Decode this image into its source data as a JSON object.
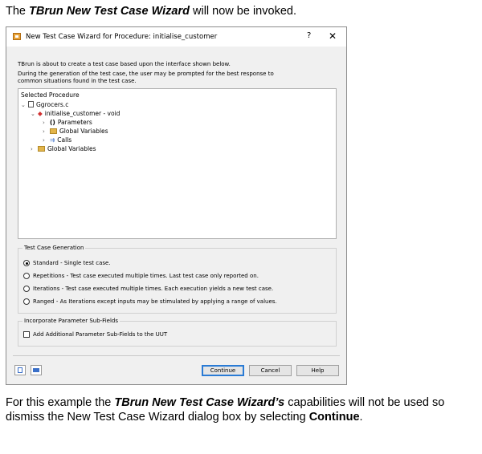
{
  "doc": {
    "intro": {
      "prefix": "The ",
      "emph": "TBrun New Test Case Wizard",
      "suffix": " will now be invoked."
    },
    "outro": {
      "p1": "For this example the ",
      "emph": "TBrun New Test Case Wizard’s",
      "p2": " capabilities will not be used so dismiss the New Test Case Wizard dialog box by selecting ",
      "bold": "Continue",
      "p3": "."
    }
  },
  "dialog": {
    "title": "New Test Case Wizard for Procedure: initialise_customer",
    "help_label": "?",
    "close_label": "✕",
    "desc1": "TBrun is about to create a test case based upon the interface shown below.",
    "desc2": "During the generation of the test case, the user may be prompted for the best response to common situations found in the test case.",
    "tree": {
      "header": "Selected Procedure",
      "file": "Ggrocers.c",
      "procedure": "initialise_customer - void",
      "parameters": "Parameters",
      "proc_globals": "Global Variables",
      "calls": "Calls",
      "globals": "Global Variables",
      "parameters_glyph": "()"
    },
    "test_case_generation": {
      "label": "Test Case Generation",
      "options": [
        {
          "label": "Standard - Single test case.",
          "selected": true
        },
        {
          "label": "Repetitions - Test case executed multiple times. Last test case only reported on.",
          "selected": false
        },
        {
          "label": "Iterations - Test case executed multiple times. Each execution yields a new test case.",
          "selected": false
        },
        {
          "label": "Ranged - As Iterations except inputs may be stimulated by applying a range of values.",
          "selected": false
        }
      ]
    },
    "parameter_subfields": {
      "label": "Incorporate Parameter Sub-Fields",
      "checkbox_label": "Add Additional Parameter Sub-Fields to the UUT",
      "checked": false
    },
    "buttons": {
      "continue": "Continue",
      "cancel": "Cancel",
      "help": "Help"
    }
  }
}
